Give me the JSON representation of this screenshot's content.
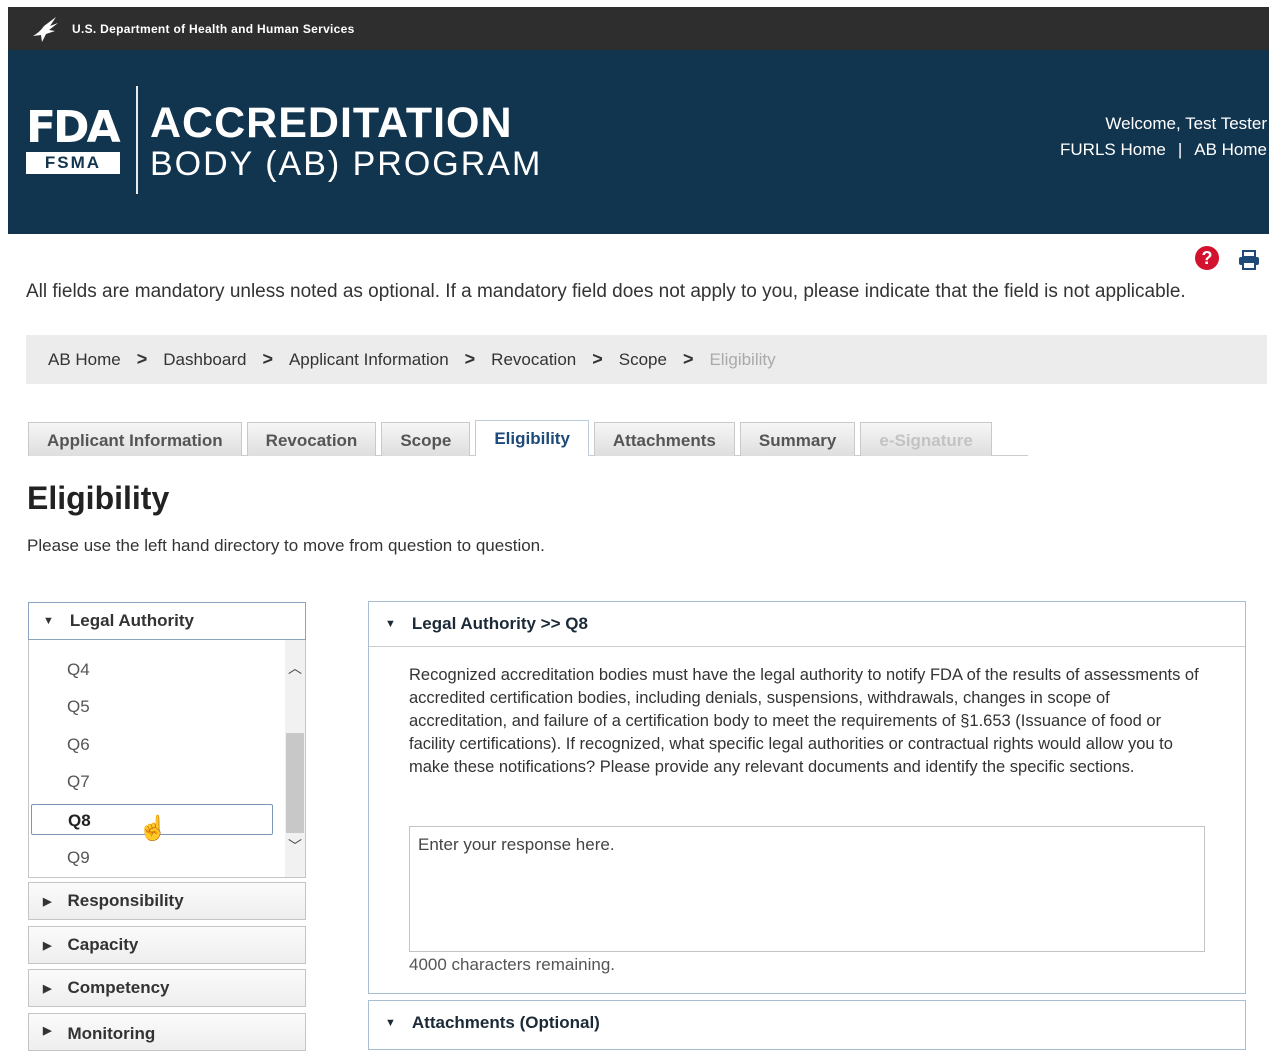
{
  "hhs": {
    "agency": "U.S. Department of Health and Human Services",
    "icon": "hhs-eagle-icon"
  },
  "banner": {
    "logo_fda": "FDA",
    "logo_fsma": "FSMA",
    "title_line1": "ACCREDITATION",
    "title_line2": "BODY (AB) PROGRAM",
    "welcome": "Welcome, Test Tester",
    "links": {
      "furls_home": "FURLS Home",
      "separator": "|",
      "ab_home": "AB Home"
    }
  },
  "tools": {
    "help_icon": "help-icon",
    "help_glyph": "?",
    "print_icon": "print-icon"
  },
  "notice": "All fields are mandatory unless noted as optional. If a mandatory field does not apply to you, please indicate that the field is not applicable.",
  "breadcrumb": {
    "items": [
      "AB Home",
      "Dashboard",
      "Applicant Information",
      "Revocation",
      "Scope"
    ],
    "current": "Eligibility",
    "separator": ">"
  },
  "tabs": [
    {
      "label": "Applicant Information",
      "state": "normal"
    },
    {
      "label": "Revocation",
      "state": "normal"
    },
    {
      "label": "Scope",
      "state": "normal"
    },
    {
      "label": "Eligibility",
      "state": "active"
    },
    {
      "label": "Attachments",
      "state": "normal"
    },
    {
      "label": "Summary",
      "state": "normal"
    },
    {
      "label": "e-Signature",
      "state": "disabled"
    }
  ],
  "page": {
    "title": "Eligibility",
    "instructions": "Please use the left hand directory to move from question to question."
  },
  "directory": {
    "sections": [
      {
        "label": "Legal Authority",
        "expanded": true
      },
      {
        "label": "Responsibility",
        "expanded": false
      },
      {
        "label": "Capacity",
        "expanded": false
      },
      {
        "label": "Competency",
        "expanded": false
      },
      {
        "label": "Monitoring",
        "expanded": false
      }
    ],
    "questions": [
      "Q4",
      "Q5",
      "Q6",
      "Q7",
      "Q8",
      "Q9"
    ],
    "selected_question": "Q8"
  },
  "question_card": {
    "heading": "Legal Authority >> Q8",
    "text": "Recognized accreditation bodies must have the legal authority to notify FDA of the results of assessments of accredited certification bodies, including denials, suspensions, withdrawals, changes in scope of accreditation, and failure of a certification body to meet the requirements of §1.653 (Issuance of food or facility certifications). If recognized, what specific legal authorities or contractual rights would allow you to make these notifications? Please provide any relevant documents and identify the specific sections.",
    "response_placeholder": "Enter your response here.",
    "response_value": "",
    "chars_remaining": "4000 characters remaining."
  },
  "attachments_card": {
    "heading": "Attachments (Optional)"
  },
  "colors": {
    "banner": "#12354f",
    "hhs_bar": "#2e2e2e",
    "help_red": "#d2122e",
    "link_blue": "#1e4a7a"
  }
}
